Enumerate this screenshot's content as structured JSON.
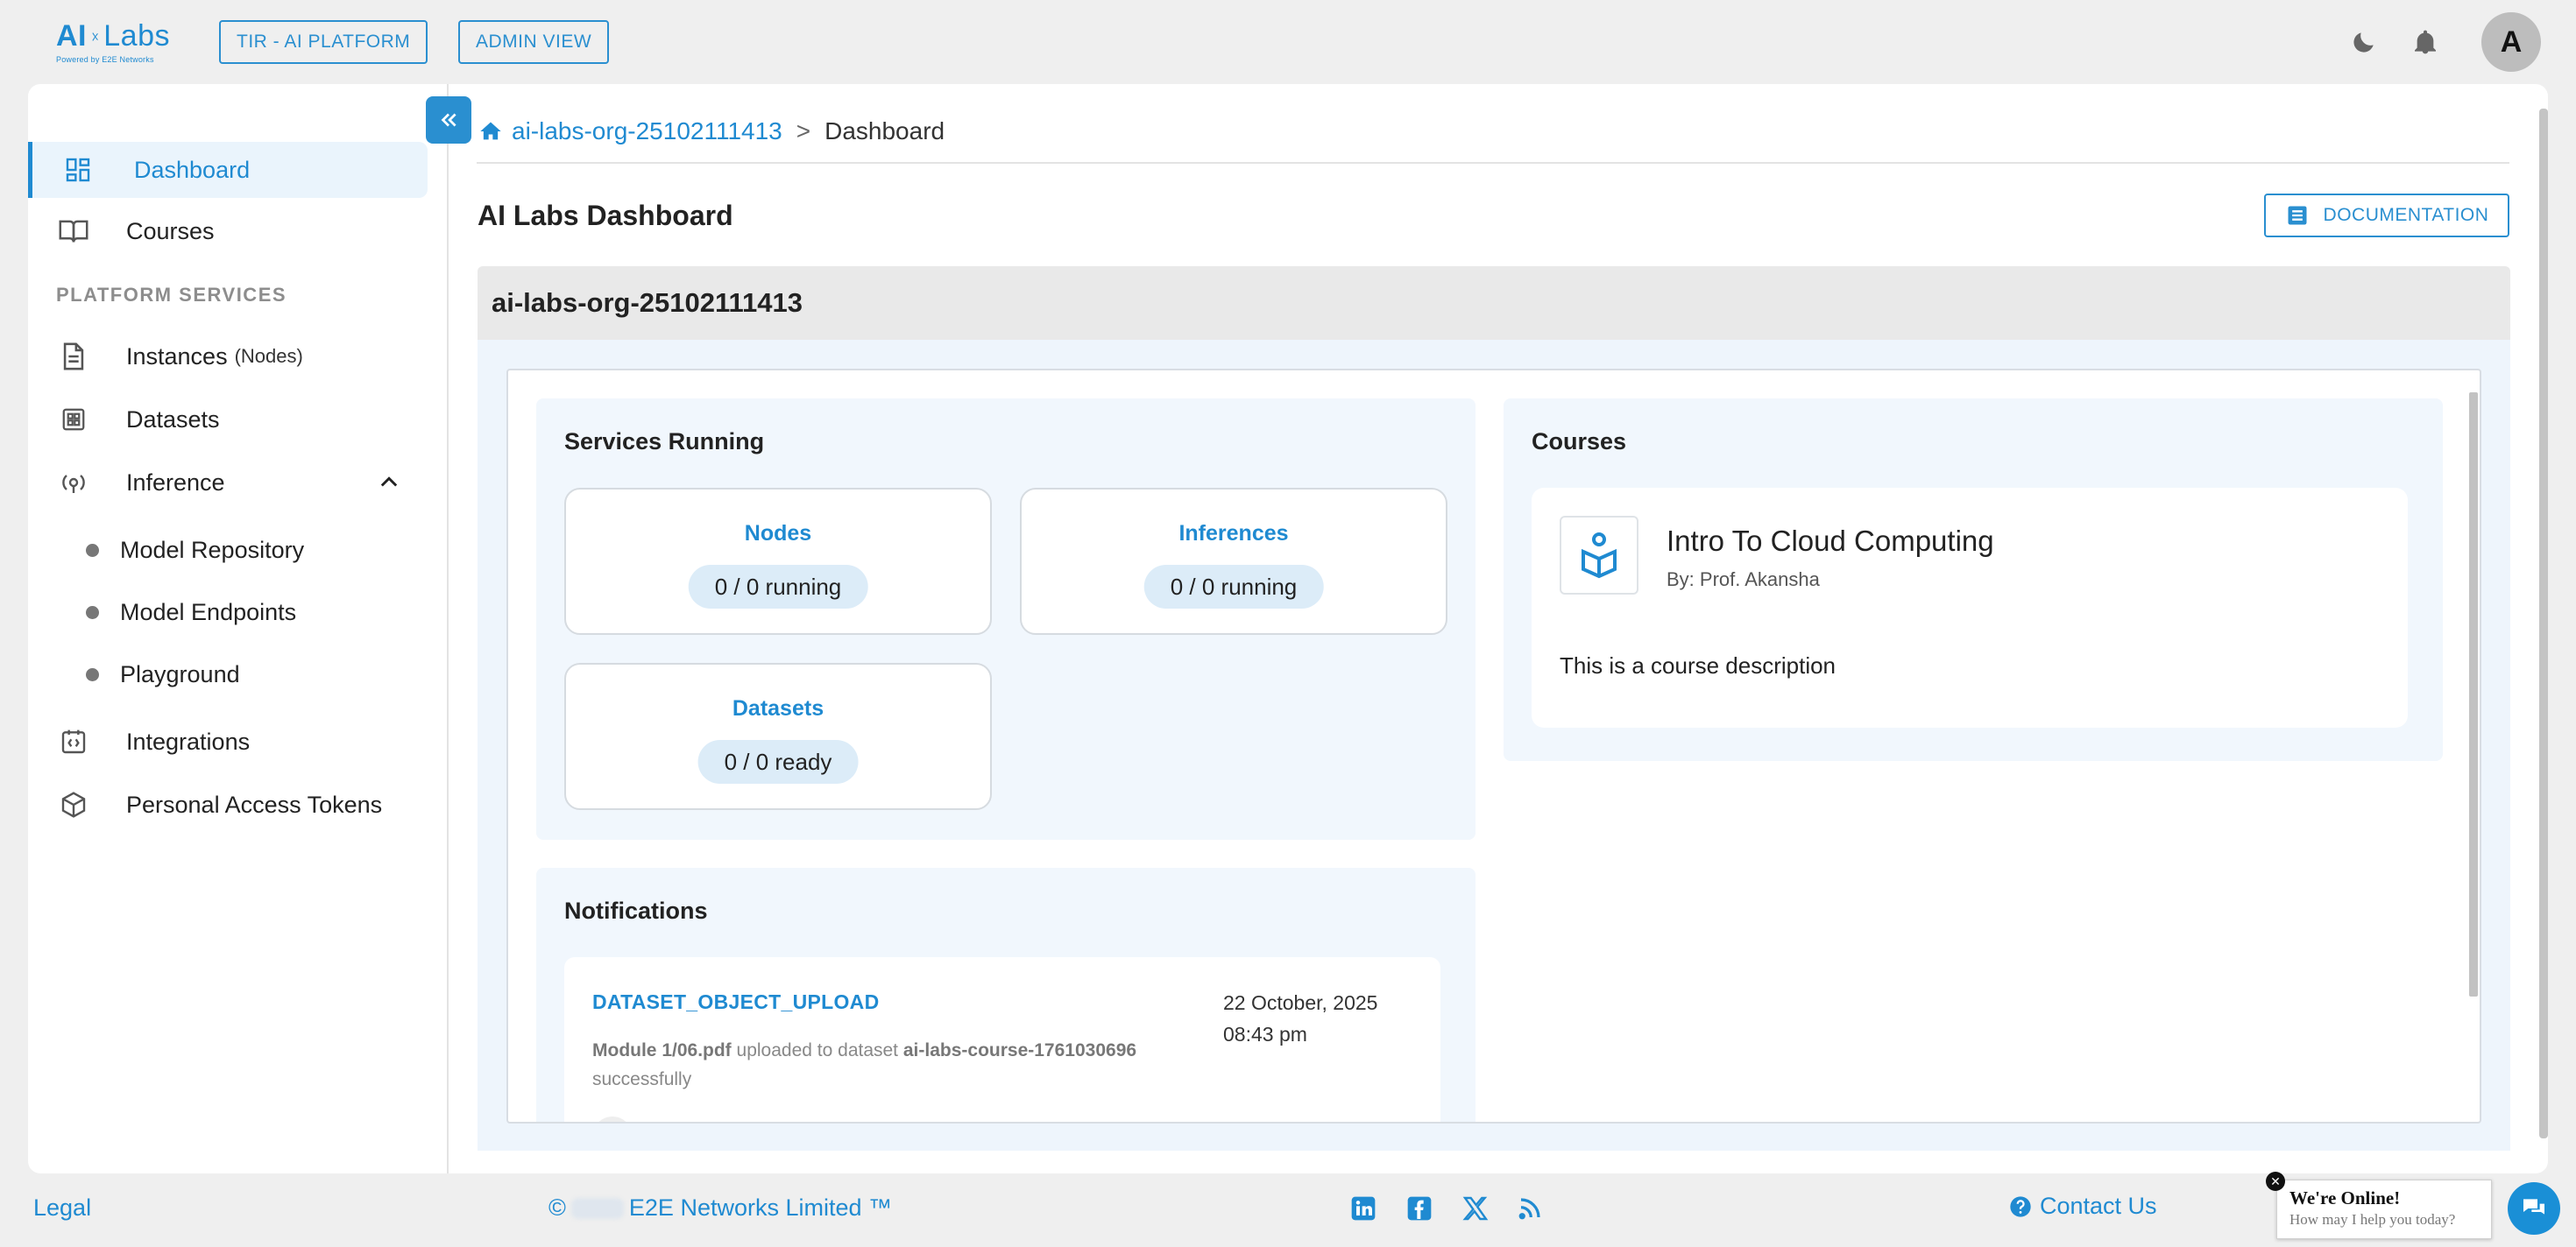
{
  "header": {
    "logo_text": "AI Labs",
    "logo_ai": "AI",
    "logo_labs": "Labs",
    "logo_sub": "Powered by E2E Networks",
    "platform_btn": "TIR - AI PLATFORM",
    "admin_btn": "ADMIN VIEW",
    "avatar_letter": "A",
    "icons": [
      "moon-icon",
      "bell-icon"
    ]
  },
  "sidebar": {
    "items": [
      {
        "label": "Dashboard",
        "icon": "dashboard-icon",
        "active": true
      },
      {
        "label": "Courses",
        "icon": "book-icon"
      }
    ],
    "section_label": "PLATFORM SERVICES",
    "services": [
      {
        "label": "Instances",
        "suffix": "(Nodes)",
        "icon": "document-icon"
      },
      {
        "label": "Datasets",
        "icon": "grid-icon"
      },
      {
        "label": "Inference",
        "icon": "inference-icon",
        "expanded": true
      }
    ],
    "inference_children": [
      "Model Repository",
      "Model Endpoints",
      "Playground"
    ],
    "bottom_items": [
      {
        "label": "Integrations",
        "icon": "integrations-icon"
      },
      {
        "label": "Personal Access Tokens",
        "icon": "token-icon"
      }
    ]
  },
  "breadcrumb": {
    "org": "ai-labs-org-25102111413",
    "separator": ">",
    "current": "Dashboard"
  },
  "page": {
    "title": "AI Labs Dashboard",
    "doc_button": "DOCUMENTATION",
    "org_name": "ai-labs-org-25102111413"
  },
  "services": {
    "title": "Services Running",
    "cards": [
      {
        "title": "Nodes",
        "value": "0 / 0 running"
      },
      {
        "title": "Inferences",
        "value": "0 / 0 running"
      },
      {
        "title": "Datasets",
        "value": "0 / 0 ready"
      }
    ]
  },
  "courses": {
    "title": "Courses",
    "items": [
      {
        "name": "Intro To Cloud Computing",
        "author": "By: Prof. Akansha",
        "description": "This is a course description"
      }
    ]
  },
  "notifications": {
    "title": "Notifications",
    "items": [
      {
        "type": "DATASET_OBJECT_UPLOAD",
        "time": "22 October, 2025 08:43 pm",
        "file": "Module 1/06.pdf",
        "mid": "uploaded to dataset",
        "dataset": "ai-labs-course-1761030696",
        "end": "successfully"
      }
    ]
  },
  "footer": {
    "legal": "Legal",
    "copyright_symbol": "©",
    "company": "E2E Networks Limited ™",
    "contact": "Contact Us",
    "social_icons": [
      "linkedin-icon",
      "facebook-icon",
      "x-icon",
      "rss-icon"
    ]
  },
  "chat": {
    "title": "We're Online!",
    "subtitle": "How may I help you today?"
  },
  "colors": {
    "accent": "#1f8ad1",
    "background": "#efefef",
    "panel": "#f1f7fd"
  }
}
